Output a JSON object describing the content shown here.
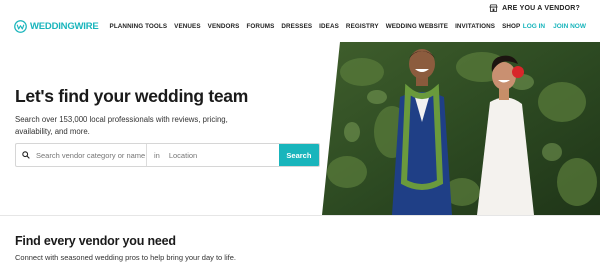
{
  "brand": {
    "name": "WEDDINGWIRE",
    "accent": "#19b5bc",
    "logo_icon": "weddingwire-logo-icon"
  },
  "vendor_bar": {
    "label": "ARE YOU A VENDOR?",
    "icon": "storefront-icon"
  },
  "nav": {
    "links": [
      "PLANNING TOOLS",
      "VENUES",
      "VENDORS",
      "FORUMS",
      "DRESSES",
      "IDEAS",
      "REGISTRY",
      "WEDDING WEBSITE",
      "INVITATIONS",
      "SHOP"
    ],
    "login": "LOG IN",
    "join": "JOIN NOW"
  },
  "hero": {
    "headline": "Let's find your wedding team",
    "subtext": "Search over 153,000 local professionals with reviews, pricing, availability, and more.",
    "search": {
      "category_placeholder": "Search vendor category or name",
      "in_label": "in",
      "location_placeholder": "Location",
      "button": "Search",
      "icon": "search-icon"
    },
    "image": "wedding-couple-photo"
  },
  "section": {
    "title": "Find every vendor you need",
    "subtitle": "Connect with seasoned wedding pros to help bring your day to life."
  }
}
